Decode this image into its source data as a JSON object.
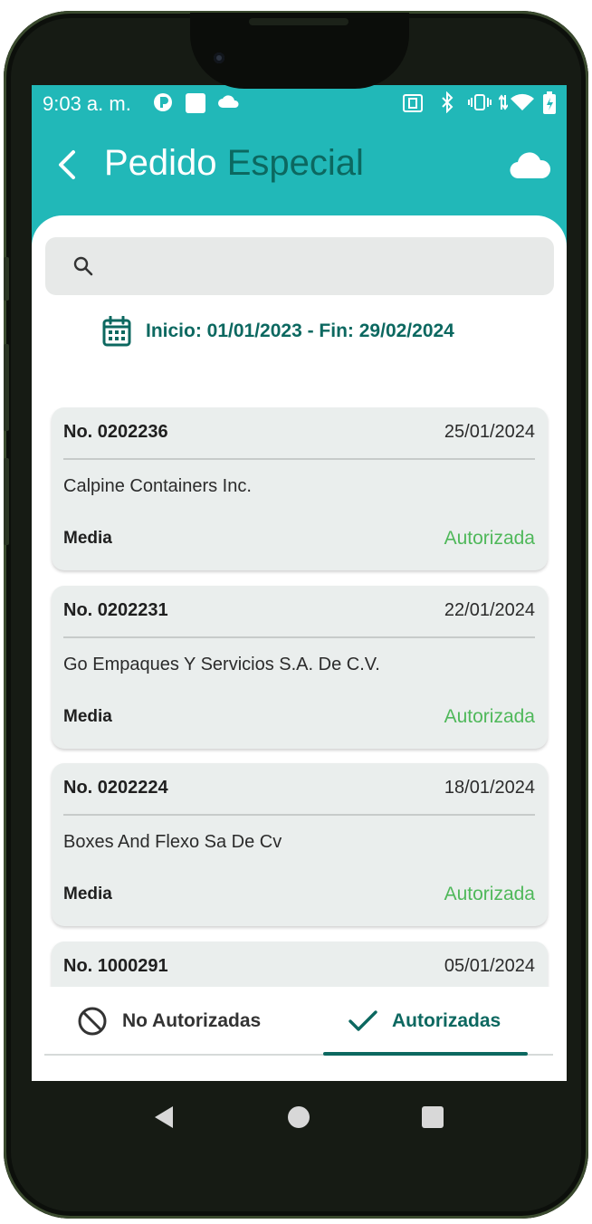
{
  "status_bar": {
    "time": "9:03 a. m.",
    "icons": [
      "app-notification-icon",
      "square-notification-icon",
      "cloud-icon",
      "nfc-icon",
      "bluetooth-icon",
      "vibrate-icon",
      "data-arrows-icon",
      "wifi-icon",
      "battery-icon"
    ]
  },
  "header": {
    "title_part1": "Pedido",
    "title_part2": "Especial",
    "back_icon": "chevron-left-icon",
    "cloud_icon": "cloud-icon"
  },
  "search": {
    "placeholder": "",
    "value": ""
  },
  "date_range": {
    "label": "Inicio: 01/01/2023 - Fin: 29/02/2024"
  },
  "orders": [
    {
      "number": "No. 0202236",
      "date": "25/01/2024",
      "company": "Calpine Containers Inc.",
      "priority": "Media",
      "status": "Autorizada"
    },
    {
      "number": "No. 0202231",
      "date": "22/01/2024",
      "company": "Go Empaques Y Servicios S.A. De C.V.",
      "priority": "Media",
      "status": "Autorizada"
    },
    {
      "number": "No. 0202224",
      "date": "18/01/2024",
      "company": "Boxes And Flexo Sa De Cv",
      "priority": "Media",
      "status": "Autorizada"
    },
    {
      "number": "No. 1000291",
      "date": "05/01/2024",
      "company": "",
      "priority": "",
      "status": ""
    }
  ],
  "tabs": [
    {
      "label": "No Autorizadas",
      "icon": "block-icon",
      "selected": false
    },
    {
      "label": "Autorizadas",
      "icon": "check-icon",
      "selected": true
    }
  ],
  "colors": {
    "header_bg": "#21b8b8",
    "accent": "#0c6860",
    "status_green": "#4fb85a",
    "card_bg": "#eaeeed"
  }
}
